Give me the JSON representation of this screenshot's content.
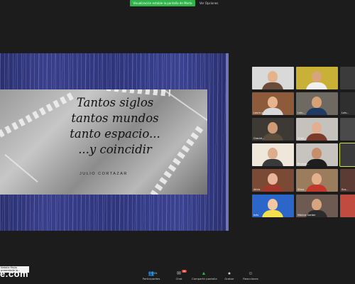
{
  "top_bar": {
    "share_banner": "Visualización estable la pantalla de Marta",
    "view_options": "Ver Opciones"
  },
  "slide": {
    "quote_lines": [
      "Tantos siglos",
      "tantos mundos",
      "tanto espacio...",
      "...y coincidir"
    ],
    "author": "JULIO CORTAZAR"
  },
  "gallery": {
    "tiles": [
      {
        "name": "",
        "bg": "#d9d9d9",
        "skin": "#e2b48c",
        "shirt": "#6b4b3a"
      },
      {
        "name": "",
        "bg": "#c9b037",
        "skin": "#d7a47c",
        "shirt": "#f0f0f0"
      },
      {
        "name": "Laura y ...",
        "bg": "#8d5a3a",
        "skin": "#e7b48f",
        "shirt": "#d9d9d9"
      },
      {
        "name": "Luis...",
        "bg": "#6e6a61",
        "skin": "#d6a177",
        "shirt": "#1f3a63"
      },
      {
        "name": "Graciel...",
        "bg": "#3d3a36",
        "skin": "#cd9c77",
        "shirt": "#5a4c3a"
      },
      {
        "name": "Sirtel...",
        "bg": "#c5c2bd",
        "skin": "#e1b092",
        "shirt": "#7b3b2a"
      },
      {
        "name": "",
        "bg": "#efe8da",
        "skin": "#dcae8d",
        "shirt": "#3a3a3a"
      },
      {
        "name": "Ricardo...",
        "bg": "#c7c3be",
        "skin": "#c48f6a",
        "shirt": "#1e1e1e"
      },
      {
        "name": "Alicia",
        "bg": "#7b4a35",
        "skin": "#e9b49a",
        "shirt": "#9f3a2d"
      },
      {
        "name": "Silvia",
        "bg": "#9b7d5d",
        "skin": "#e4b08c",
        "shirt": "#c0392b"
      },
      {
        "name": "Inés",
        "bg": "#2c66c9",
        "skin": "#f1c8a2",
        "shirt": "#f4e04d"
      },
      {
        "name": "Mónica Garber",
        "bg": "#6d5b52",
        "skin": "#d6a57f",
        "shirt": "#2b2b2b"
      }
    ],
    "partial_tiles": [
      "",
      "Luis...",
      "",
      "",
      "Sus...",
      ""
    ]
  },
  "bottom_left": {
    "name_label": "Natalia Mejia presentada la...",
    "watermark": "e.com"
  },
  "toolbar": {
    "participants_label": "Participantes",
    "participants_count": "24",
    "chat_label": "Chat",
    "chat_badge": "99",
    "share_label": "Compartir pantalla",
    "record_label": "Grabar",
    "reactions_label": "Reacciones"
  },
  "colors": {
    "share_green": "#2fb34a",
    "slide_blue": "#2f357a",
    "background": "#1c1c1c"
  }
}
